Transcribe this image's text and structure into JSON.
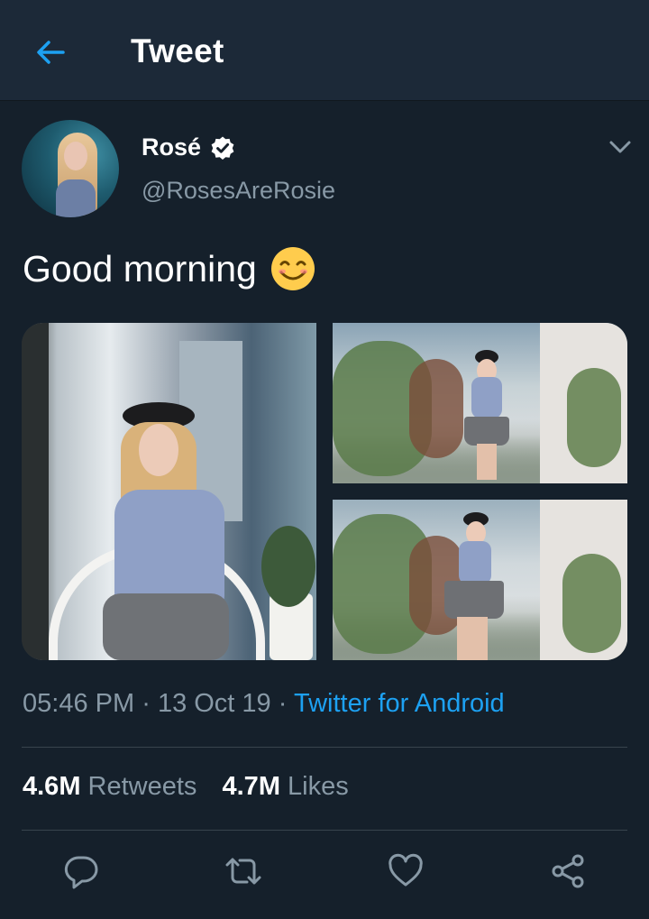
{
  "app_bar": {
    "title": "Tweet",
    "back_icon": "arrow-left-icon"
  },
  "tweet": {
    "author": {
      "name": "Rosé",
      "handle": "@RosesAreRosie",
      "verified": true
    },
    "text": "Good morning",
    "emoji": "smiling-face-icon",
    "photos": 3,
    "timestamp": "05:46 PM",
    "separator": "·",
    "date": "13 Oct 19",
    "source": "Twitter for Android",
    "stats": {
      "retweets_count": "4.6M",
      "retweets_label": "Retweets",
      "likes_count": "4.7M",
      "likes_label": "Likes"
    }
  },
  "actions": [
    "reply-icon",
    "retweet-icon",
    "like-icon",
    "share-icon"
  ],
  "colors": {
    "background": "#15202b",
    "app_bar": "#1c2938",
    "accent": "#1da1f2",
    "secondary_text": "#8899a6",
    "divider": "#38444d"
  }
}
